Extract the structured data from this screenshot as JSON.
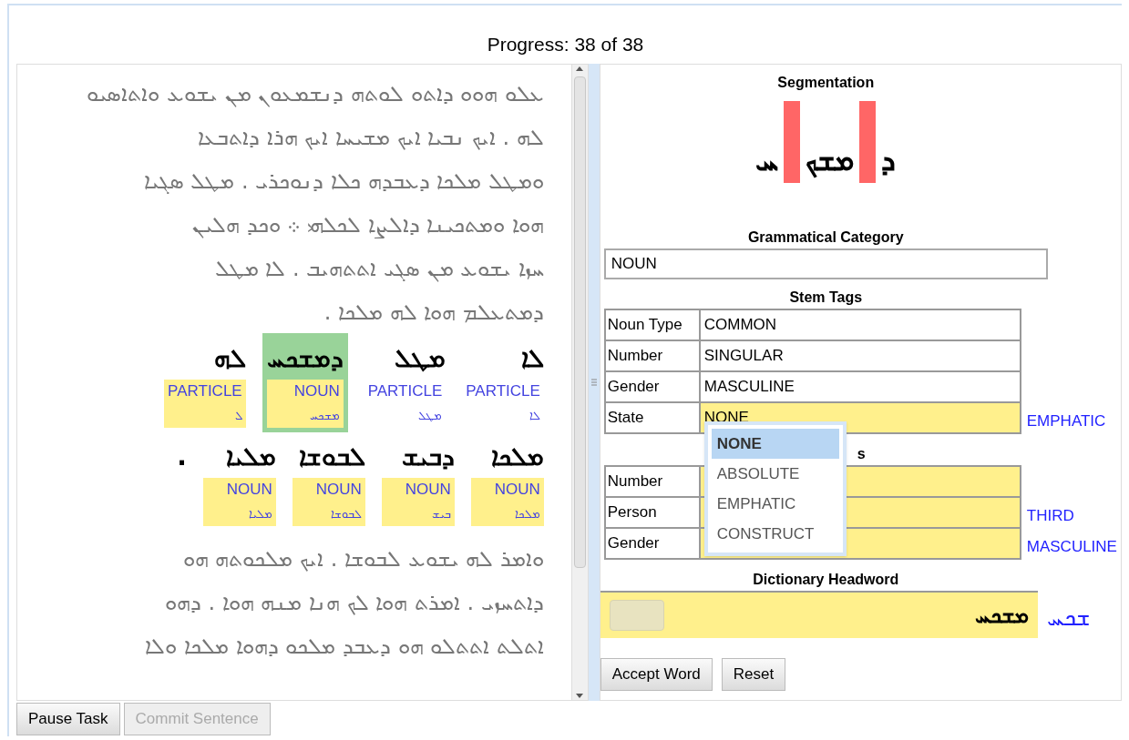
{
  "progress": "Progress: 38 of 38",
  "text_before": [
    "ܥܠܘ ܗܘܘ ܕܐܬܘ ܠܘܬܗ ܕܢܫܡܥܘܢ ܡܢ ܝܫܘܥ ܘܐܬܐܣܝܘ",
    "ܠܗ . ܐܝܟ ܢܒܝܐ ܐܝܟ ܡܫܝܚܐ ܐܝܟ ܗܪܐ ܕܐܬܒܥܐ",
    "ܘܡܛܠ ܡܠܟܐ ܕܥܒܕܗ ܟܠܐ ܕܢܘܟܪܝ . ܡܛܠ ܣܓܝܐ",
    "ܗܘܐ ܘܡܬܟܝܢܐ ܕܐܠܨܐ ܠܟܠܗܝ ܀ ܘܟܕ ܗܠܝܢ",
    "ܚܙܐ ܝܫܘܥ ܡܢ ܣܓܝ ܐܬܬܗܝܒ . ܠܐ ܡܛܠ",
    "ܕܡܬܥܠܡ ܗܘܐ ܠܗ ܡܠܟܐ ."
  ],
  "token_rows": [
    {
      "tokens": [
        {
          "word": "ܠܐ",
          "pos": "PARTICLE",
          "lemma": "ܠܐ",
          "annotated": false,
          "selected": false
        },
        {
          "word": "ܡܛܠ",
          "pos": "PARTICLE",
          "lemma": "ܡܛܠ",
          "annotated": false,
          "selected": false
        },
        {
          "word": "ܕܡܫܟܚ",
          "pos": "NOUN",
          "lemma": "ܡܫܟܚ",
          "annotated": true,
          "selected": true
        },
        {
          "word": "ܠܗ",
          "pos": "PARTICLE",
          "lemma": "ܠ",
          "annotated": true,
          "selected": false
        }
      ]
    },
    {
      "tokens": [
        {
          "word": "ܡܠܟܐ",
          "pos": "NOUN",
          "lemma": "ܡܠܟܐ",
          "annotated": true,
          "selected": false
        },
        {
          "word": "ܕܒܝܫ",
          "pos": "NOUN",
          "lemma": "ܒܝܫ",
          "annotated": true,
          "selected": false
        },
        {
          "word": "ܠܒܘܫܐ",
          "pos": "NOUN",
          "lemma": "ܠܒܘܫܐ",
          "annotated": true,
          "selected": false
        },
        {
          "word": "ܡܠܝܐ",
          "pos": "NOUN",
          "lemma": "ܡܠܝܐ",
          "annotated": true,
          "selected": false
        }
      ],
      "punctuation": "."
    }
  ],
  "text_after": [
    "ܘܐܡܪ ܠܗ ܝܫܘܥ ܠܒܘܫܐ . ܐܝܟ ܡܠܟܘܬܗ ܗܘ",
    "ܕܐܬܚܙܝ . ܐܡܪܬ ܗܘܐ ܠܟ ܗܢܐ ܡܢܗ ܗܘܐ . ܕܗܘ",
    "ܐܬܠܬ ܐܬܬܠܘ ܗܘ ܕܥܒܕ ܡܠܟܘ ܕܗܘܐ ܡܠܟܐ ܘܠܐ"
  ],
  "pause_button": {
    "label": "Pause Task",
    "disabled": false
  },
  "commit_button": {
    "label": "Commit Sentence",
    "disabled": true
  },
  "segmentation": {
    "title": "Segmentation",
    "segments": [
      "ܕ",
      "ܡܫܟ",
      "ܚ"
    ]
  },
  "grammatical_category": {
    "title": "Grammatical Category",
    "value": "NOUN"
  },
  "stem_tags": {
    "title": "Stem Tags",
    "rows": [
      {
        "label": "Noun Type",
        "value": "COMMON",
        "highlighted": false
      },
      {
        "label": "Number",
        "value": "SINGULAR",
        "highlighted": false
      },
      {
        "label": "Gender",
        "value": "MASCULINE",
        "highlighted": false
      },
      {
        "label": "State",
        "value": "NONE",
        "highlighted": true,
        "suggestion": "EMPHATIC"
      }
    ]
  },
  "suffix_tags": {
    "title": "s",
    "rows": [
      {
        "label": "Number",
        "highlighted": true
      },
      {
        "label": "Person",
        "highlighted": true,
        "suggestion": "THIRD"
      },
      {
        "label": "Gender",
        "highlighted": true,
        "suggestion": "MASCULINE"
      }
    ]
  },
  "dropdown": {
    "options": [
      {
        "label": "NONE",
        "selected": true
      },
      {
        "label": "ABSOLUTE",
        "selected": false
      },
      {
        "label": "EMPHATIC",
        "selected": false
      },
      {
        "label": "CONSTRUCT",
        "selected": false
      }
    ]
  },
  "headword": {
    "title": "Dictionary Headword",
    "value": "ܡܫܟܚ",
    "suggestion": "ܫܟܚ"
  },
  "accept_button": {
    "label": "Accept Word"
  },
  "reset_button": {
    "label": "Reset"
  }
}
